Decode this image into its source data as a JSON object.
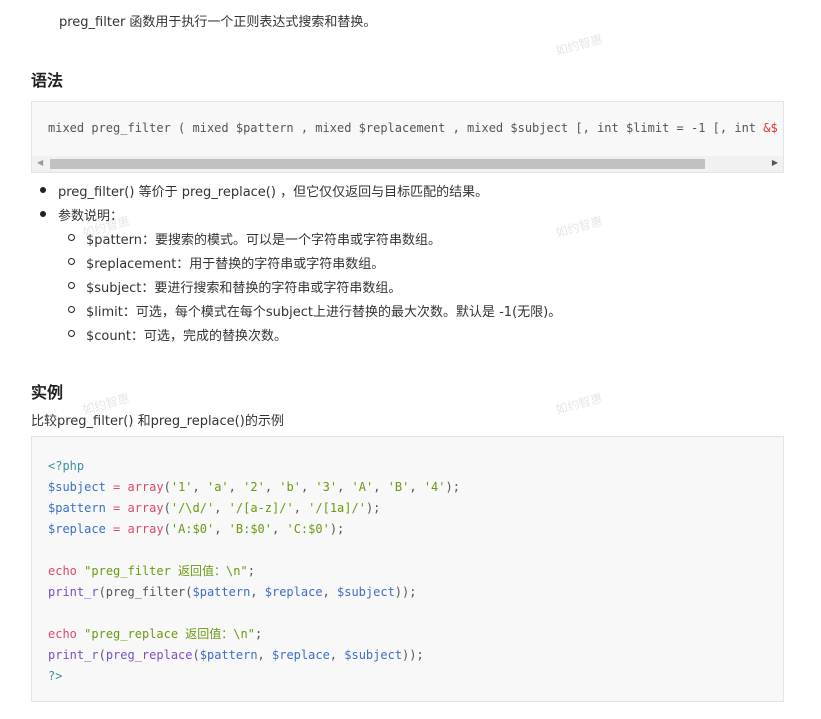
{
  "intro": "preg_filter 函数用于执行一个正则表达式搜索和替换。",
  "syntax_heading": "语法",
  "syntax_code": {
    "before": "mixed preg_filter ( mixed $pattern , mixed $replacement , mixed $subject [, int $limit = -1 [, int ",
    "amp": "&$"
  },
  "bullets": [
    {
      "text": "preg_filter() 等价于 preg_replace() ，但它仅仅返回与目标匹配的结果。"
    },
    {
      "text": "参数说明：",
      "sub": [
        "$pattern：要搜索的模式。可以是一个字符串或字符串数组。",
        "$replacement：用于替换的字符串或字符串数组。",
        "$subject：要进行搜索和替换的字符串或字符串数组。",
        "$limit：可选，每个模式在每个subject上进行替换的最大次数。默认是 -1(无限)。",
        "$count：可选，完成的替换次数。"
      ]
    }
  ],
  "example_heading": "实例",
  "example_desc": "比较preg_filter() 和preg_replace()的示例",
  "code_lines": [
    [
      [
        "<?php",
        "tag"
      ]
    ],
    [
      [
        "$subject",
        "var"
      ],
      [
        " = ",
        "kw"
      ],
      [
        "array",
        "kw"
      ],
      [
        "(",
        "p"
      ],
      [
        "'1'",
        "str"
      ],
      [
        ", ",
        "p"
      ],
      [
        "'a'",
        "str"
      ],
      [
        ", ",
        "p"
      ],
      [
        "'2'",
        "str"
      ],
      [
        ", ",
        "p"
      ],
      [
        "'b'",
        "str"
      ],
      [
        ", ",
        "p"
      ],
      [
        "'3'",
        "str"
      ],
      [
        ", ",
        "p"
      ],
      [
        "'A'",
        "str"
      ],
      [
        ", ",
        "p"
      ],
      [
        "'B'",
        "str"
      ],
      [
        ", ",
        "p"
      ],
      [
        "'4'",
        "str"
      ],
      [
        ");",
        "p"
      ]
    ],
    [
      [
        "$pattern",
        "var"
      ],
      [
        " = ",
        "kw"
      ],
      [
        "array",
        "kw"
      ],
      [
        "(",
        "p"
      ],
      [
        "'/\\d/'",
        "str"
      ],
      [
        ", ",
        "p"
      ],
      [
        "'/[a-z]/'",
        "str"
      ],
      [
        ", ",
        "p"
      ],
      [
        "'/[1a]/'",
        "str"
      ],
      [
        ");",
        "p"
      ]
    ],
    [
      [
        "$replace",
        "var"
      ],
      [
        " = ",
        "kw"
      ],
      [
        "array",
        "kw"
      ],
      [
        "(",
        "p"
      ],
      [
        "'A:$0'",
        "str"
      ],
      [
        ", ",
        "p"
      ],
      [
        "'B:$0'",
        "str"
      ],
      [
        ", ",
        "p"
      ],
      [
        "'C:$0'",
        "str"
      ],
      [
        ");",
        "p"
      ]
    ],
    [],
    [
      [
        "echo",
        "kw"
      ],
      [
        " ",
        "p"
      ],
      [
        "\"preg_filter 返回值：\\n\"",
        "str"
      ],
      [
        ";",
        "p"
      ]
    ],
    [
      [
        "print_r",
        "fn"
      ],
      [
        "(preg_filter(",
        "p"
      ],
      [
        "$pattern",
        "var"
      ],
      [
        ", ",
        "p"
      ],
      [
        "$replace",
        "var"
      ],
      [
        ", ",
        "p"
      ],
      [
        "$subject",
        "var"
      ],
      [
        "));",
        "p"
      ]
    ],
    [],
    [
      [
        "echo",
        "kw"
      ],
      [
        " ",
        "p"
      ],
      [
        "\"preg_replace 返回值：\\n\"",
        "str"
      ],
      [
        ";",
        "p"
      ]
    ],
    [
      [
        "print_r",
        "fn"
      ],
      [
        "(",
        "p"
      ],
      [
        "preg_replace",
        "fn"
      ],
      [
        "(",
        "p"
      ],
      [
        "$pattern",
        "var"
      ],
      [
        ", ",
        "p"
      ],
      [
        "$replace",
        "var"
      ],
      [
        ", ",
        "p"
      ],
      [
        "$subject",
        "var"
      ],
      [
        "));",
        "p"
      ]
    ],
    [
      [
        "?>",
        "tag"
      ]
    ]
  ],
  "watermark": "如约智惠"
}
